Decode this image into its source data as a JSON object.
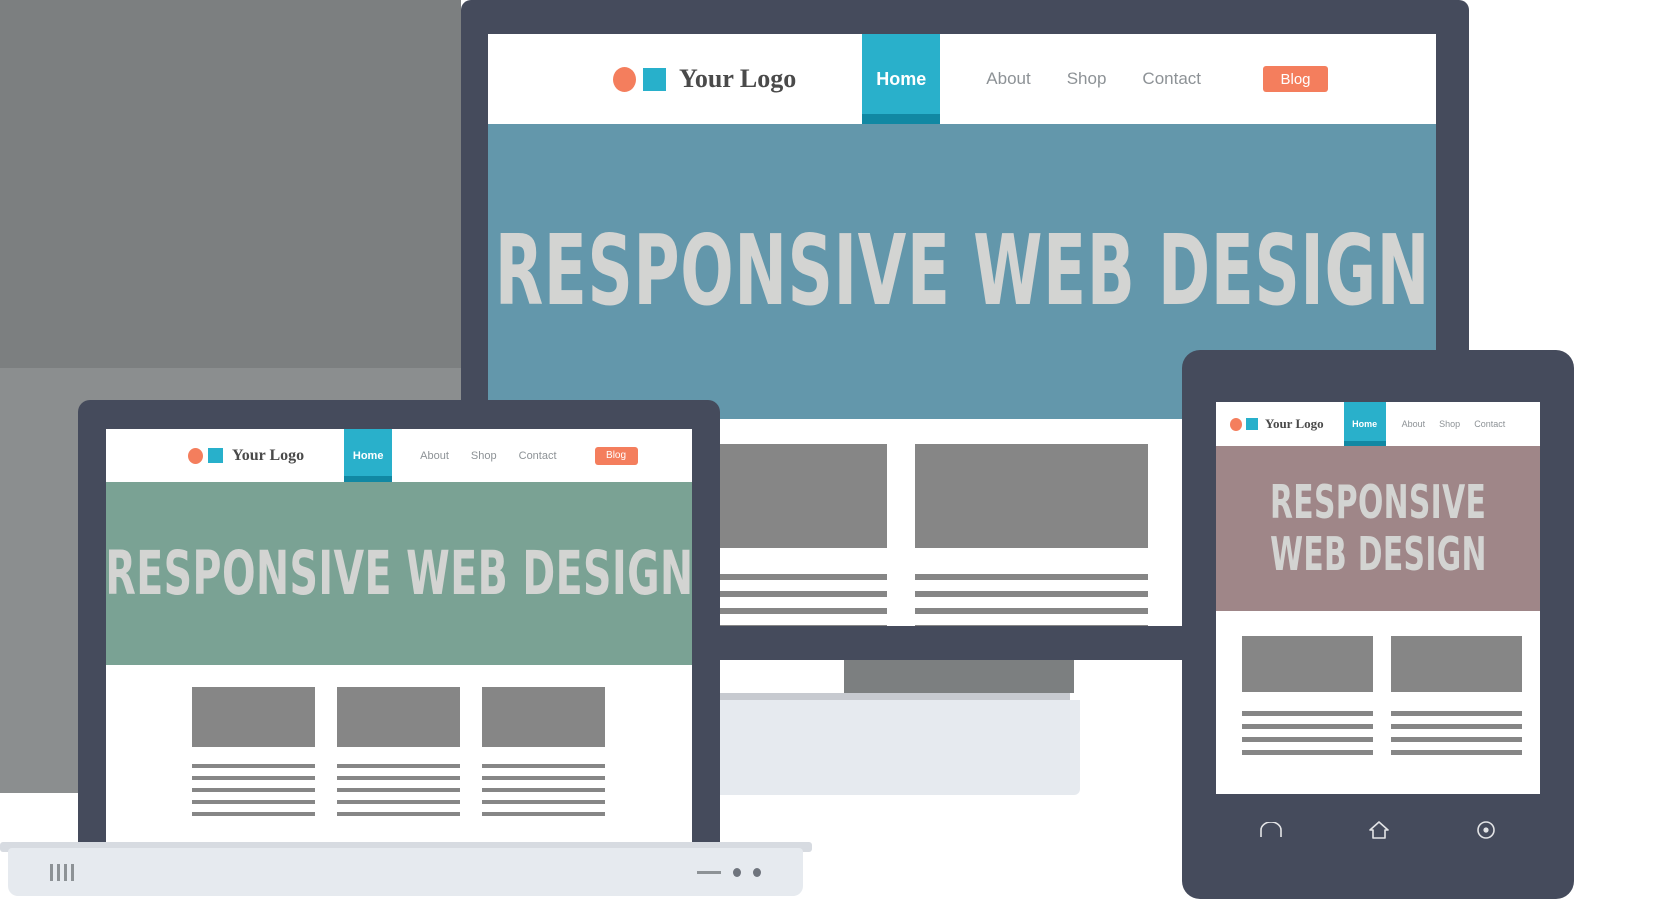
{
  "brand": {
    "logo_text": "Your Logo",
    "logo_circle_icon": "circle-icon",
    "logo_square_icon": "square-icon",
    "accent_orange": "#f47e5d",
    "accent_teal": "#29b0cb",
    "accent_teal_dark": "#1188a3",
    "device_frame": "#454b5c",
    "muted_text": "#8d9296",
    "placeholder_gray": "#868686",
    "hero_text_gray": "#d3d4d2"
  },
  "nav": {
    "home_label": "Home",
    "links": [
      "About",
      "Shop",
      "Contact"
    ],
    "blog_label": "Blog"
  },
  "desktop": {
    "device_name": "desktop-monitor",
    "hero_title": "RESPONSIVE WEB DESIGN",
    "hero_bg": "#6397ab",
    "cards": [
      {
        "lines": 4
      },
      {
        "lines": 4
      },
      {
        "lines": 4
      }
    ]
  },
  "laptop": {
    "device_name": "laptop",
    "hero_title": "RESPONSIVE WEB DESIGN",
    "hero_bg": "#7aa294",
    "cards": [
      {
        "lines": 5
      },
      {
        "lines": 5
      },
      {
        "lines": 5
      }
    ],
    "base": {
      "ports_icon": "ports-icon",
      "dash_icon": "dash-icon",
      "dots_icon": "dots-icon"
    }
  },
  "tablet": {
    "device_name": "tablet",
    "hero_title_line1": "RESPONSIVE",
    "hero_title_line2": "WEB DESIGN",
    "hero_bg": "#9f8688",
    "nav_links": [
      "About",
      "Shop",
      "Contact"
    ],
    "cards": [
      {
        "lines": 4
      },
      {
        "lines": 4
      }
    ],
    "buttons": [
      "back-icon",
      "home-icon",
      "recent-icon"
    ]
  }
}
